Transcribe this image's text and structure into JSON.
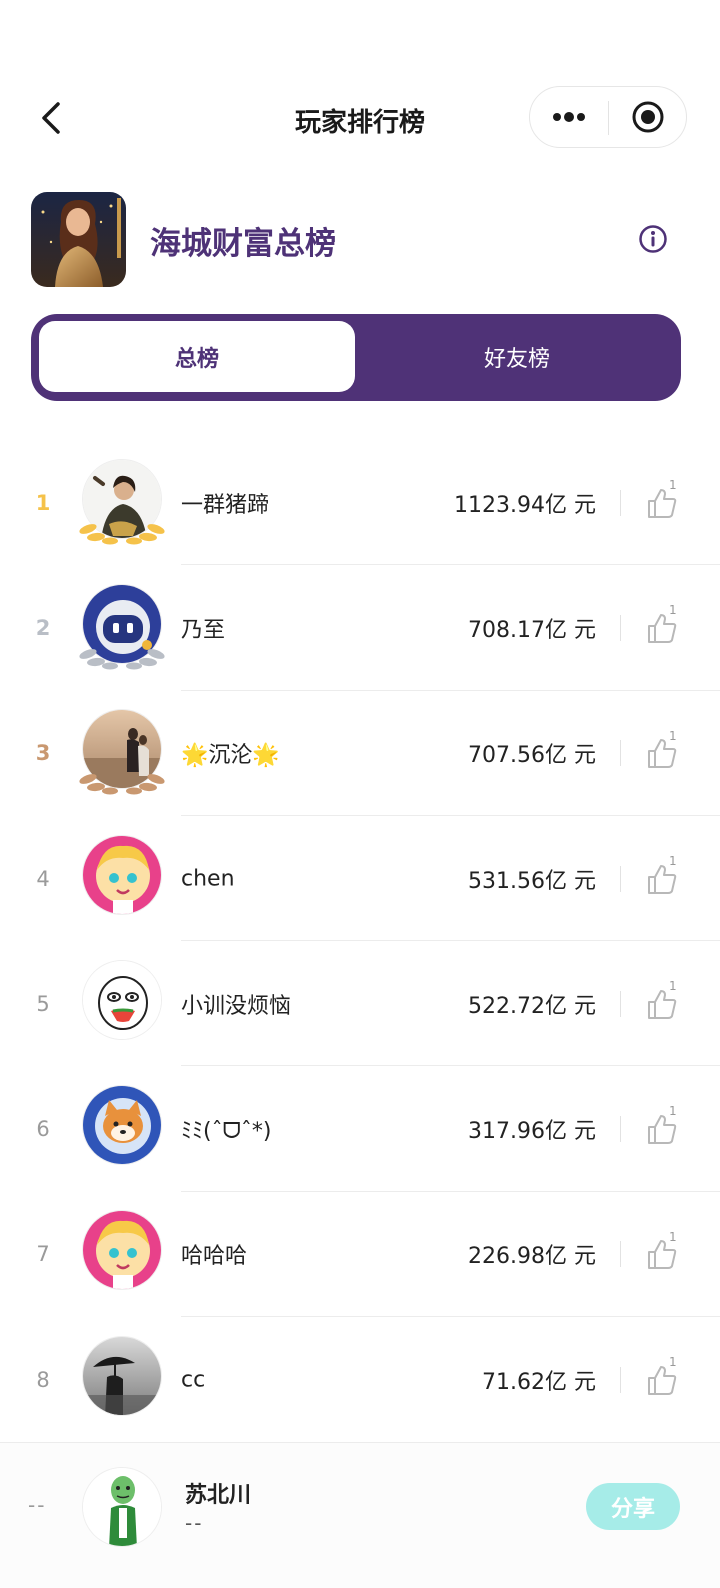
{
  "header": {
    "title": "玩家排行榜"
  },
  "game": {
    "title": "海城财富总榜"
  },
  "tabs": [
    {
      "label": "总榜",
      "active": true
    },
    {
      "label": "好友榜",
      "active": false
    }
  ],
  "colors": {
    "brand": "#4f3277",
    "gold": "#f5c24a",
    "silver": "#b9bec6",
    "bronze": "#c99870",
    "share": "#a6ece8"
  },
  "rankings": [
    {
      "rank": "1",
      "name": "一群猪蹄",
      "score": "1123.94亿 元",
      "likes": "1",
      "avatar": "portrait-avatar"
    },
    {
      "rank": "2",
      "name": "乃至",
      "score": "708.17亿 元",
      "likes": "1",
      "avatar": "robot-avatar"
    },
    {
      "rank": "3",
      "name": "🌟沉沦🌟",
      "score": "707.56亿 元",
      "likes": "1",
      "avatar": "couple-avatar"
    },
    {
      "rank": "4",
      "name": "chen",
      "score": "531.56亿 元",
      "likes": "1",
      "avatar": "cartoon-girl-avatar"
    },
    {
      "rank": "5",
      "name": "小训没烦恼",
      "score": "522.72亿 元",
      "likes": "1",
      "avatar": "meme-face-avatar"
    },
    {
      "rank": "6",
      "name": "ﾐﾐ(ˆᗜˆ*)",
      "score": "317.96亿 元",
      "likes": "1",
      "avatar": "shiba-avatar"
    },
    {
      "rank": "7",
      "name": "哈哈哈",
      "score": "226.98亿 元",
      "likes": "1",
      "avatar": "cartoon-girl-avatar"
    },
    {
      "rank": "8",
      "name": "cc",
      "score": "71.62亿 元",
      "likes": "1",
      "avatar": "umbrella-avatar"
    }
  ],
  "me": {
    "rank": "--",
    "name": "苏北川",
    "score": "--"
  },
  "share": {
    "label": "分享"
  }
}
